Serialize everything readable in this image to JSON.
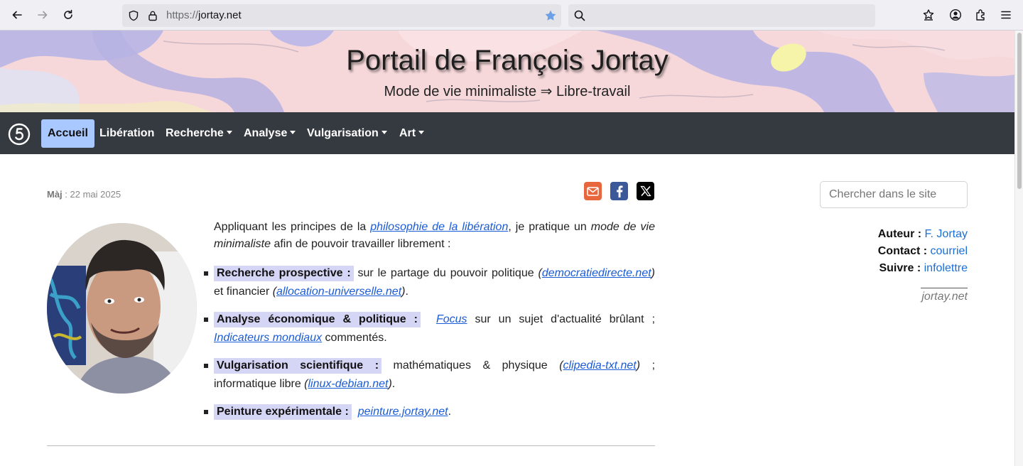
{
  "browser": {
    "url_protocol": "https://",
    "url_host": "jortay.net",
    "search_placeholder": ""
  },
  "banner": {
    "title": "Portail de François Jortay",
    "subtitle": "Mode de vie minimaliste ⇒ Libre-travail"
  },
  "navbar": {
    "items": [
      {
        "label": "Accueil",
        "active": true,
        "dropdown": false
      },
      {
        "label": "Libération",
        "active": false,
        "dropdown": false
      },
      {
        "label": "Recherche",
        "active": false,
        "dropdown": true
      },
      {
        "label": "Analyse",
        "active": false,
        "dropdown": true
      },
      {
        "label": "Vulgarisation",
        "active": false,
        "dropdown": true
      },
      {
        "label": "Art",
        "active": false,
        "dropdown": true
      }
    ]
  },
  "meta": {
    "updated_label": "Màj",
    "updated_sep": " : ",
    "updated_date": "22 mai 2025"
  },
  "share": {
    "email_color": "#e8663d",
    "facebook_color": "#3b5998",
    "x_color": "#000000"
  },
  "intro": {
    "p1": "Appliquant les principes de la ",
    "link1": "philosophie de la libération",
    "p2": ", je pratique un ",
    "em1": "mode de vie minimaliste",
    "p3": " afin de pouvoir travailler librement :"
  },
  "bullets": [
    {
      "heading": "Recherche prospective :",
      "t1": " sur le partage du pouvoir politique ",
      "link1": "democratiedirecte.net",
      "t2": " et financier ",
      "link2": "allocation-universelle.net",
      "t3": "."
    },
    {
      "heading": "Analyse économique & politique :",
      "link1": "Focus",
      "t1": " sur un sujet d'actualité brûlant ; ",
      "link2": "Indicateurs mondiaux",
      "t2": " commentés."
    },
    {
      "heading": "Vulgarisation scientifique :",
      "t1": " mathématiques & physique ",
      "link1": "clipedia-txt.net",
      "t2": " ; informatique libre ",
      "link2": "linux-debian.net",
      "t3": "."
    },
    {
      "heading": "Peinture expérimentale :",
      "link1": "peinture.jortay.net",
      "t1": "."
    }
  ],
  "sidebar": {
    "search_placeholder": "Chercher dans le site",
    "author_label": "Auteur :",
    "author_link": "F. Jortay",
    "contact_label": "Contact :",
    "contact_link": "courriel",
    "follow_label": "Suivre :",
    "follow_link": "infolettre",
    "site_name": "jortay.net"
  },
  "colors": {
    "accent": "#a9c8ff",
    "navbar_bg": "#343a40",
    "link": "#1a5bd6",
    "highlight": "#d5d5f5"
  }
}
